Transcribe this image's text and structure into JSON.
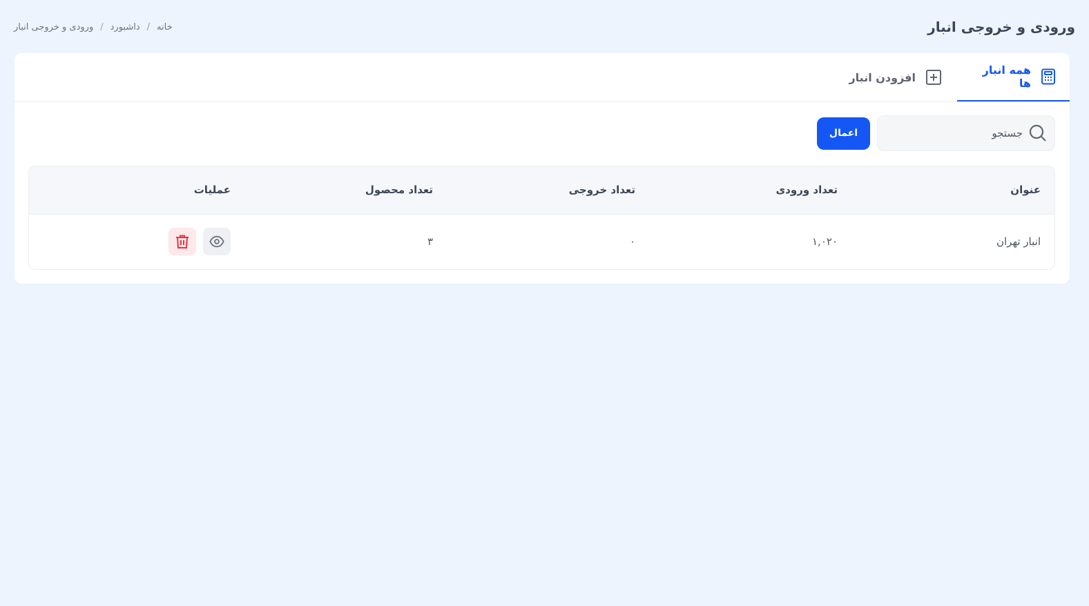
{
  "header": {
    "title": "ورودی و خروجی انبار",
    "breadcrumb": [
      "خانه",
      "داشبورد",
      "ورودی و خروجی انبار"
    ]
  },
  "tabs": [
    {
      "label": "همه انبار ها",
      "icon": "calculator-icon",
      "active": true
    },
    {
      "label": "افزودن انبار",
      "icon": "plus-square-icon",
      "active": false
    }
  ],
  "search": {
    "placeholder": "جستجو",
    "value": "",
    "apply_label": "اعمال"
  },
  "table": {
    "columns": [
      "عنوان",
      "تعداد ورودی",
      "تعداد خروجی",
      "تعداد محصول",
      "عملیات"
    ],
    "rows": [
      {
        "title": "انبار تهران",
        "in": "۱,۰۲۰",
        "out": "۰",
        "count": "۳"
      }
    ]
  },
  "colors": {
    "accent": "#1457f5",
    "danger": "#f0303e",
    "background": "#edf4fd"
  }
}
